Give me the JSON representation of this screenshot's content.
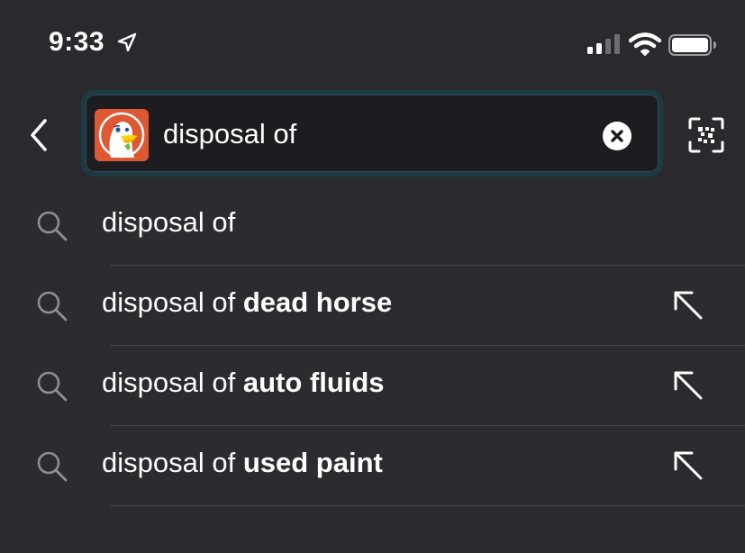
{
  "status_bar": {
    "time": "9:33"
  },
  "address_bar": {
    "query": "disposal of"
  },
  "suggestions": [
    {
      "prefix": "disposal of",
      "completion": "",
      "show_fill": false
    },
    {
      "prefix": "disposal of ",
      "completion": "dead horse",
      "show_fill": true
    },
    {
      "prefix": "disposal of ",
      "completion": "auto fluids",
      "show_fill": true
    },
    {
      "prefix": "disposal of ",
      "completion": "used paint",
      "show_fill": true
    }
  ],
  "icons": {
    "back": "chevron-left-icon",
    "logo": "duckduckgo-logo",
    "clear": "clear-icon",
    "qr": "qr-scan-icon",
    "suggestion": "search-icon",
    "fill": "arrow-up-left-icon"
  },
  "colors": {
    "background": "#2b2b30",
    "search_border": "#1e3b44",
    "search_fill": "#1d1d21",
    "logo_orange": "#de5833",
    "text": "#ffffff",
    "muted_icon": "#8e8e93"
  }
}
